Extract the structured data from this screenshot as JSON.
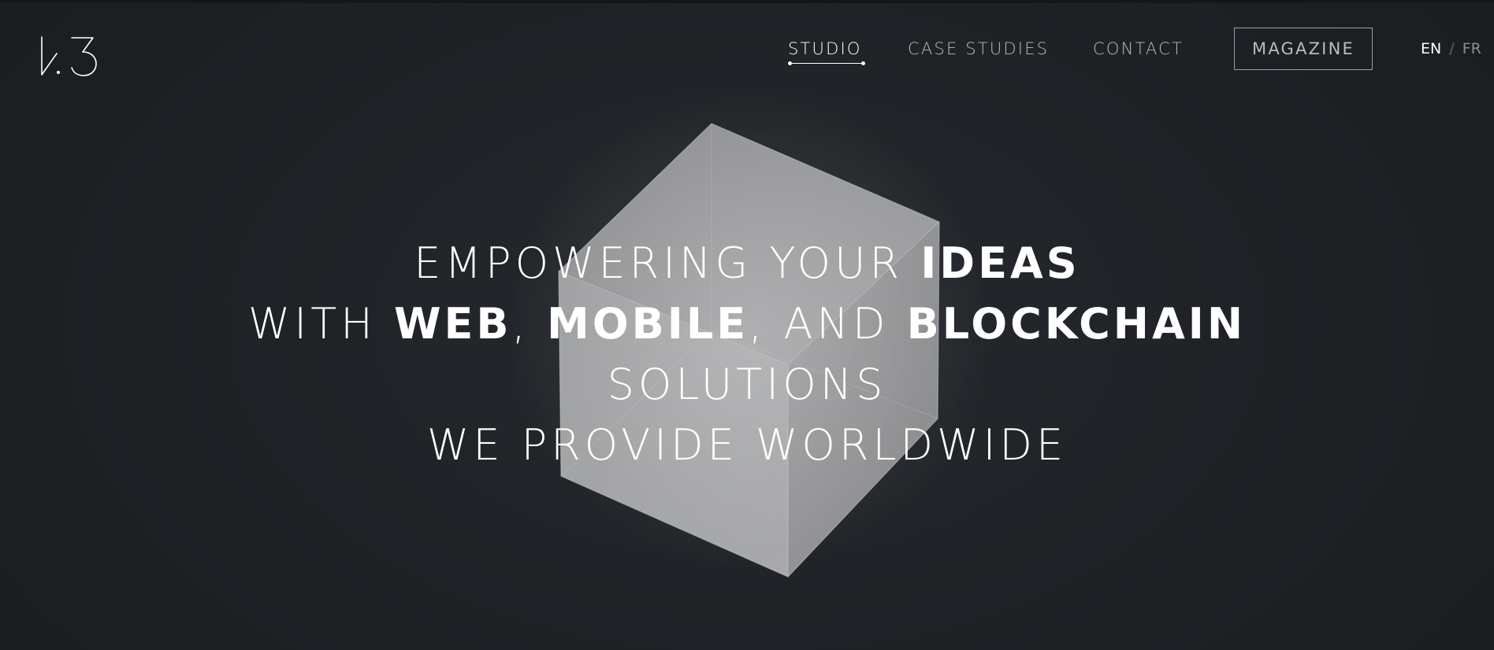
{
  "logo": {
    "icon": "w3-logo-icon"
  },
  "nav": {
    "items": [
      {
        "label": "STUDIO",
        "active": true
      },
      {
        "label": "CASE STUDIES",
        "active": false
      },
      {
        "label": "CONTACT",
        "active": false
      }
    ],
    "magazine_label": "MAGAZINE"
  },
  "lang": {
    "current": "EN",
    "separator": "/",
    "other": "FR"
  },
  "hero": {
    "line1_a": "EMPOWERING YOUR ",
    "line1_b": "IDEAS",
    "line2_a": "WITH ",
    "line2_b": "WEB",
    "line2_c": ", ",
    "line2_d": "MOBILE",
    "line2_e": ", AND ",
    "line2_f": "BLOCKCHAIN",
    "line3": "SOLUTIONS",
    "line4": "WE PROVIDE WORLDWIDE"
  },
  "colors": {
    "background": "#1e2124",
    "text": "#ffffff",
    "muted": "#b9bcbf"
  }
}
